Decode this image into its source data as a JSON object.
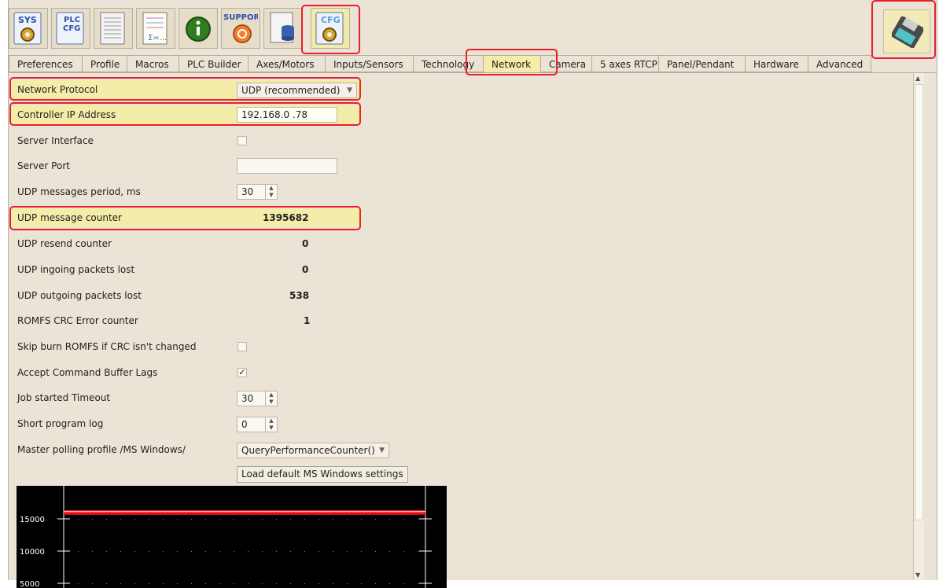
{
  "toolbar": {
    "buttons": [
      {
        "icon": "sys-gear-icon",
        "text": "SYS"
      },
      {
        "icon": "plc-cfg-icon",
        "text": "PLC CFG"
      },
      {
        "icon": "document-icon",
        "text": ""
      },
      {
        "icon": "formula-sheet-icon",
        "text": "Σ=..."
      },
      {
        "icon": "info-icon",
        "text": ""
      },
      {
        "icon": "support-icon",
        "text": "SUPPORT"
      },
      {
        "icon": "database-icon",
        "text": ""
      },
      {
        "icon": "cfg-gear-icon",
        "text": "CFG"
      }
    ],
    "save_icon": "floppy-disk-icon"
  },
  "tabs": [
    "Preferences",
    "Profile",
    "Macros",
    "PLC Builder",
    "Axes/Motors",
    "Inputs/Sensors",
    "Technology",
    "Network",
    "Camera",
    "5 axes RTCP",
    "Panel/Pendant",
    "Hardware",
    "Advanced"
  ],
  "active_tab": "Network",
  "settings": {
    "network_protocol": {
      "label": "Network Protocol",
      "value": "UDP (recommended)"
    },
    "controller_ip": {
      "label": "Controller IP Address",
      "value": "192.168.0  .78"
    },
    "server_interface": {
      "label": "Server Interface",
      "checked": false
    },
    "server_port": {
      "label": "Server Port",
      "value": ""
    },
    "udp_period": {
      "label": "UDP messages period, ms",
      "value": "30"
    },
    "udp_counter": {
      "label": "UDP message counter",
      "value": "1395682"
    },
    "udp_resend": {
      "label": "UDP resend counter",
      "value": "0"
    },
    "udp_in_lost": {
      "label": "UDP ingoing packets lost",
      "value": "0"
    },
    "udp_out_lost": {
      "label": "UDP outgoing packets lost",
      "value": "538"
    },
    "romfs_crc": {
      "label": "ROMFS CRC Error counter",
      "value": "1"
    },
    "skip_burn": {
      "label": "Skip burn ROMFS if CRC isn't changed",
      "checked": false
    },
    "accept_lags": {
      "label": "Accept Command Buffer Lags",
      "checked": true,
      "mark": "✓"
    },
    "job_timeout": {
      "label": "Job started Timeout",
      "value": "30"
    },
    "short_log": {
      "label": "Short program log",
      "value": "0"
    },
    "master_polling": {
      "label": "Master polling profile /MS Windows/",
      "value": "QueryPerformanceCounter()"
    },
    "load_defaults_button": "Load default MS Windows settings"
  },
  "chart": {
    "y_ticks": [
      "15000",
      "10000",
      "5000"
    ],
    "line_value": 16000,
    "colors": {
      "background": "#000000",
      "line": "#e8101a",
      "axis": "#ffffff"
    }
  },
  "colors": {
    "highlight": "#f4eda9",
    "annotation": "#e8202a",
    "panel": "#ebe3d5"
  }
}
